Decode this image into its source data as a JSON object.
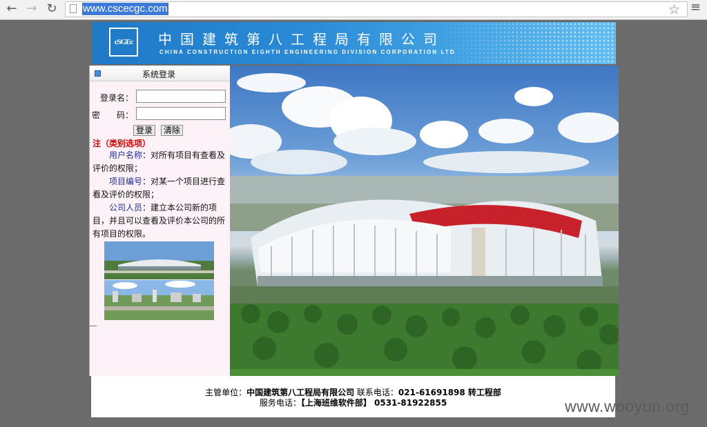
{
  "browser": {
    "url": "www.cscecgc.com"
  },
  "banner": {
    "logo_text": "cSGEc",
    "cn_name": "中国建筑第八工程局有限公司",
    "en_name": "CHINA CONSTRUCTION EIGHTH ENGINEERING DIVISION CORPORATION LTD"
  },
  "login": {
    "title": "系统登录",
    "username_label": "登录名：",
    "password_label": "密　　码：",
    "login_button": "登录",
    "clear_button": "清除",
    "note_title": "注（类别选项）",
    "notes": [
      {
        "term": "用户名称",
        "text": "：对所有项目有查看及评价的权限；"
      },
      {
        "term": "项目编号",
        "text": "：对某一个项目进行查看及评价的权限；"
      },
      {
        "term": "公司人员",
        "text": "：建立本公司新的项目，并且可以查看及评价本公司的所有项目的权限。"
      }
    ]
  },
  "footer": {
    "line1_label": "主管单位：",
    "line1_org": "中国建筑第八工程局有限公司",
    "line1_phone_label": " 联系电话：",
    "line1_phone": "021-61691898 转工程部",
    "line2_label": "服务电话：",
    "line2_value": "【上海班维软件部】 0531-81922855"
  },
  "watermark": "www.wooyun.org",
  "colors": {
    "banner_blue": "#2a8ad6",
    "note_red": "#d40000",
    "term_blue": "#1d2f9b"
  }
}
